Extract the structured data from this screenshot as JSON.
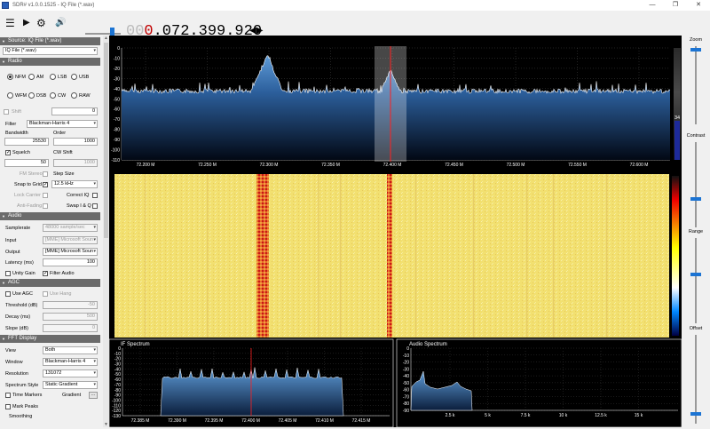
{
  "window": {
    "title": "SDR# v1.0.0.1525 - IQ File (*.wav)",
    "min": "—",
    "max": "❐",
    "close": "✕"
  },
  "toolbar": {
    "menu_icon": "☰",
    "play_icon": "▶",
    "gear_icon": "⚙",
    "freq_lead": "000.",
    "freq_main": "072.399.920",
    "freq_dim": "00",
    "freq_red": "0",
    "freq_rest": ".072.399.920",
    "arrows": "◀▶"
  },
  "sections": {
    "source": "Source: IQ File (*.wav)",
    "radio": "Radio",
    "audio": "Audio",
    "agc": "AGC",
    "fft": "FFT Display"
  },
  "source": {
    "value": "IQ File (*.wav)"
  },
  "radio": {
    "modes": [
      "NFM",
      "AM",
      "LSB",
      "USB",
      "WFM",
      "DSB",
      "CW",
      "RAW"
    ],
    "selected": "NFM",
    "shift_label": "Shift",
    "shift_value": "0",
    "filter_label": "Filter",
    "filter_value": "Blackman-Harris 4",
    "bandwidth_label": "Bandwidth",
    "bandwidth_value": "25530",
    "order_label": "Order",
    "order_value": "1000",
    "squelch_label": "Squelch",
    "cwshift_label": "CW Shift",
    "squelch_value": "50",
    "cwshift_value": "1000",
    "fm_stereo": "FM Stereo",
    "step_size_label": "Step Size",
    "snap_label": "Snap to Grid",
    "step_value": "12.5 kHz",
    "lock_carrier": "Lock Carrier",
    "correct_iq": "Correct IQ",
    "anti_fading": "Anti-Fading",
    "swap_iq": "Swap I & Q"
  },
  "audio": {
    "samplerate_label": "Samplerate",
    "samplerate_value": "48000 sample/sec",
    "input_label": "Input",
    "input_value": "[MME] Microsoft Soun",
    "output_label": "Output",
    "output_value": "[MME] Microsoft Soun",
    "latency_label": "Latency (ms)",
    "latency_value": "100",
    "unity_gain": "Unity Gain",
    "filter_audio": "Filter Audio"
  },
  "agc": {
    "use_agc": "Use AGC",
    "use_hang": "Use Hang",
    "threshold_label": "Threshold (dB)",
    "threshold_value": "-50",
    "decay_label": "Decay (ms)",
    "decay_value": "500",
    "slope_label": "Slope (dB)",
    "slope_value": "0"
  },
  "fft": {
    "view_label": "View",
    "view_value": "Both",
    "window_label": "Window",
    "window_value": "Blackman-Harris 4",
    "resolution_label": "Resolution",
    "resolution_value": "131072",
    "style_label": "Spectrum Style",
    "style_value": "Static Gradient",
    "time_markers": "Time Markers",
    "gradient_label": "Gradient",
    "gradient_btn": "...",
    "mark_peaks": "Mark Peaks",
    "smoothing": "Smoothing"
  },
  "right": {
    "zoom": "Zoom",
    "contrast": "Contrast",
    "range": "Range",
    "offset": "Offset"
  },
  "spectrum": {
    "y_ticks": [
      "0",
      "-10",
      "-20",
      "-30",
      "-40",
      "-50",
      "-60",
      "-70",
      "-80",
      "-90",
      "-100",
      "-110"
    ],
    "x_ticks": [
      "72.200 M",
      "72.250 M",
      "72.300 M",
      "72.350 M",
      "72.400 M",
      "72.450 M",
      "72.500 M",
      "72.550 M",
      "72.600 M"
    ],
    "side_value": "34"
  },
  "if_spectrum": {
    "title": "IF Spectrum",
    "y_ticks": [
      "0",
      "-10",
      "-20",
      "-30",
      "-40",
      "-50",
      "-60",
      "-70",
      "-80",
      "-90",
      "-100",
      "-110",
      "-120",
      "-130"
    ],
    "x_ticks": [
      "72.385 M",
      "72.390 M",
      "72.395 M",
      "72.400 M",
      "72.405 M",
      "72.410 M",
      "72.415 M"
    ]
  },
  "audio_spectrum": {
    "title": "Audio Spectrum",
    "y_ticks": [
      "0",
      "-10",
      "-20",
      "-30",
      "-40",
      "-50",
      "-60",
      "-70",
      "-80",
      "-90"
    ],
    "x_ticks": [
      "2.5 k",
      "5 k",
      "7.5 k",
      "10 k",
      "12.5 k",
      "15 k"
    ]
  },
  "colors": {
    "accent": "#1c74d3",
    "spectrum_fill": "#3a78b8",
    "waterfall_bg": "#f5e070",
    "red_marker": "#e00000"
  }
}
